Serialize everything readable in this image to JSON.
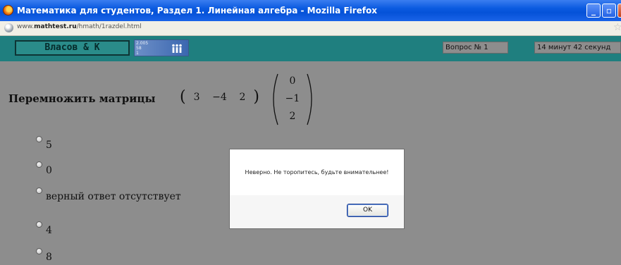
{
  "window": {
    "title": "Математика для студентов, Раздел 1. Линейная алгебра - Mozilla Firefox",
    "buttons": {
      "minimize": "_",
      "maximize": "▫",
      "close": "×"
    }
  },
  "address_bar": {
    "url_prefix": "www.",
    "url_domain": "mathtest.ru",
    "url_path": "/hmath/1razdel.html"
  },
  "header": {
    "brand": "Власов & К",
    "counter_lines": [
      "2.005",
      "58",
      "1"
    ],
    "question": "Вопрос № 1",
    "timer": "14 минут 42 секунд"
  },
  "question": {
    "label": "Перемножить матрицы",
    "row_vector": [
      "3",
      "−4",
      "2"
    ],
    "column_vector": [
      "0",
      "−1",
      "2"
    ]
  },
  "options": [
    "5",
    "0",
    "верный ответ отсутствует",
    "4",
    "8"
  ],
  "dialog": {
    "message": "Неверно. Не торопитесь, будьте внимательнее!",
    "ok_label": "OK"
  },
  "colors": {
    "titlebar": "#0a5ae0",
    "header_teal": "#1f7f7f",
    "page_background": "#8d8d8d"
  }
}
